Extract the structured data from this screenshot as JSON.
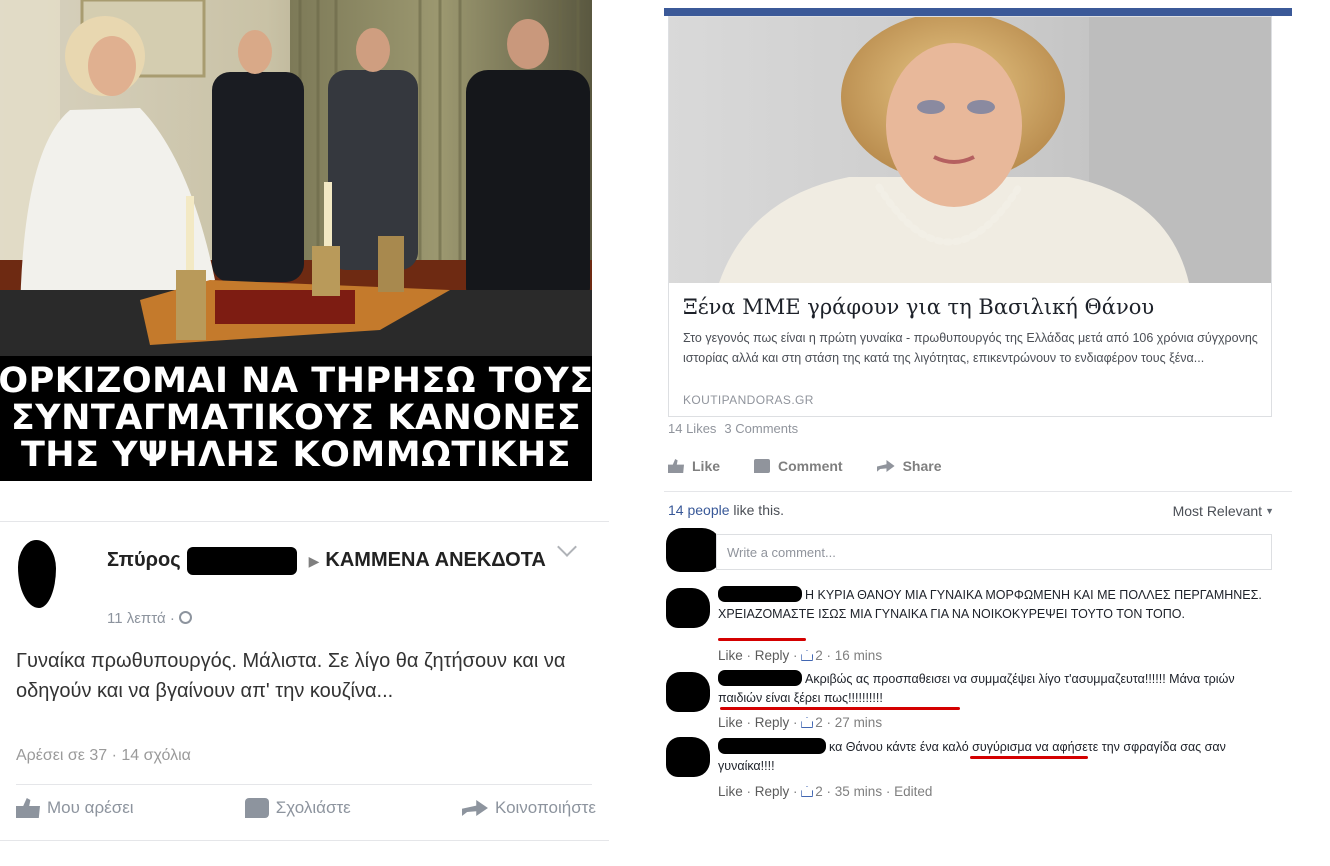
{
  "meme": {
    "caption_lines": [
      "ΟΡΚΙΖΟΜΑΙ ΝΑ ΤΗΡΗΣΩ ΤΟΥΣ",
      "ΣΥΝΤΑΓΜΑΤΙΚΟΥΣ ΚΑΝΟΝΕΣ",
      "ΤΗΣ ΥΨΗΛΗΣ ΚΟΜΜΩΤΙΚΗΣ"
    ]
  },
  "left_post": {
    "author": "Σπύρος",
    "group": "ΚΑΜΜΕΝΑ ΑΝΕΚΔΟΤΑ",
    "time": "11 λεπτά ·",
    "text": "Γυναίκα πρωθυπουργός. Μάλιστα. Σε λίγο θα ζητήσουν και να οδηγούν και να βγαίνουν απ' την κουζίνα...",
    "stats": "Αρέσει σε 37 · 14 σχόλια",
    "actions": {
      "like": "Μου αρέσει",
      "comment": "Σχολιάστε",
      "share": "Κοινοποιήστε"
    }
  },
  "fb_card": {
    "link": {
      "title": "Ξένα ΜΜΕ γράφουν για τη Βασιλική Θάνου",
      "description": "Στο γεγονός πως είναι η πρώτη γυναίκα - πρωθυπουργός της Ελλάδας μετά από 106 χρόνια σύγχρονης ιστορίας αλλά και στη στάση της κατά της λιγότητας, επικεντρώνουν το ενδιαφέρον τους ξένα...",
      "domain": "KOUTIPANDORAS.GR"
    },
    "likes_count": "14 Likes",
    "comments_count": "3 Comments",
    "actions": {
      "like": "Like",
      "comment": "Comment",
      "share": "Share"
    },
    "people_like_link": "14 people",
    "people_like_rest": " like this.",
    "sort_label": "Most Relevant",
    "composer_placeholder": "Write a comment...",
    "comments": [
      {
        "text": "Η ΚΥΡΙΑ ΘΑΝΟΥ ΜΙΑ ΓΥΝΑΙΚΑ ΜΟΡΦΩΜΕΝΗ ΚΑΙ ΜΕ ΠΟΛΛΕΣ ΠΕΡΓΑΜΗΝΕΣ. ΧΡΕΙΑΖΟΜΑΣΤΕ ΙΣΩΣ ΜΙΑ ΓΥΝΑΙΚΑ ΓΙΑ ΝΑ ΝΟΙΚΟΚΥΡΕΨΕΙ ΤΟΥΤΟ ΤΟΝ ΤΟΠΟ.",
        "like": "Like",
        "reply": "Reply",
        "likes": "2",
        "time": "16 mins",
        "edited": ""
      },
      {
        "text": "Ακριβώς ας προσπαθεισει να συμμαζέψει λίγο τ'ασυμμαζευτα!!!!!! Μάνα τριών παιδιών είναι ξέρει πως!!!!!!!!!!",
        "like": "Like",
        "reply": "Reply",
        "likes": "2",
        "time": "27 mins",
        "edited": ""
      },
      {
        "text": "κα Θάνου κάντε ένα καλό συγύρισμα να αφήσετε την σφραγίδα σας σαν γυναίκα!!!!",
        "like": "Like",
        "reply": "Reply",
        "likes": "2",
        "time": "35 mins",
        "edited": "Edited"
      }
    ]
  },
  "colors": {
    "facebook_blue": "#3b5998",
    "link_blue": "#385898",
    "underline_red": "#d40000",
    "meme_text": "#ffffff"
  }
}
